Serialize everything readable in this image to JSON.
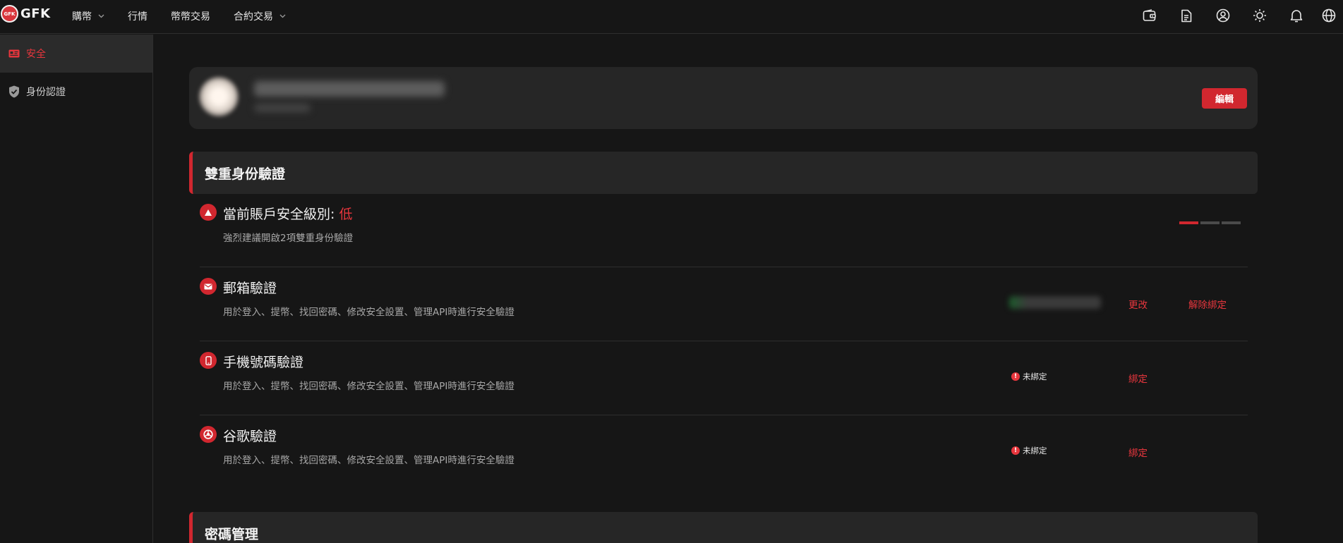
{
  "header": {
    "logo_mark": "GFK",
    "logo_text": "GFK",
    "nav": [
      {
        "label": "購幣"
      },
      {
        "label": "行情"
      },
      {
        "label": "幣幣交易"
      },
      {
        "label": "合約交易"
      }
    ],
    "tool_icons": [
      "wallet-icon",
      "document-icon",
      "account-icon",
      "theme-sun-icon",
      "notification-bell-icon",
      "language-globe-icon"
    ]
  },
  "sidebar": {
    "items": [
      {
        "label": "安全",
        "icon": "id-card-icon",
        "active": true
      },
      {
        "label": "身份認證",
        "icon": "shield-check-icon",
        "active": false
      }
    ]
  },
  "profile": {
    "edit_label": "編輯"
  },
  "two_factor": {
    "title": "雙重身份驗證",
    "level": {
      "label": "當前賬戶安全級別: ",
      "value": "低",
      "description": "強烈建議開啟2項雙重身份驗證",
      "bars_filled": 1,
      "bars_total": 3
    },
    "email": {
      "title": "郵箱驗證",
      "description": "用於登入、提幣、找回密碼、修改安全設置、管理API時進行安全驗證",
      "change_label": "更改",
      "unbind_label": "解除綁定"
    },
    "phone": {
      "title": "手機號碼驗證",
      "description": "用於登入、提幣、找回密碼、修改安全設置、管理API時進行安全驗證",
      "status": "未綁定",
      "bind_label": "綁定"
    },
    "google": {
      "title": "谷歌驗證",
      "description": "用於登入、提幣、找回密碼、修改安全設置、管理API時進行安全驗證",
      "status": "未綁定",
      "bind_label": "綁定"
    }
  },
  "password": {
    "title": "密碼管理"
  },
  "colors": {
    "accent": "#d1272f",
    "background": "#161616",
    "card": "#262626"
  }
}
